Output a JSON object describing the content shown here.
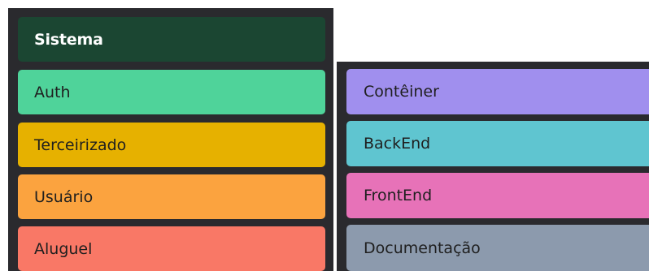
{
  "left_panel": {
    "items": [
      {
        "label": "Sistema",
        "color": "#1b4632",
        "text_color": "#ffffff",
        "kind": "header"
      },
      {
        "label": "Auth",
        "color": "#4fd39a"
      },
      {
        "label": "Terceirizado",
        "color": "#e6b100"
      },
      {
        "label": "Usuário",
        "color": "#fba33f"
      },
      {
        "label": "Aluguel",
        "color": "#f97866"
      }
    ]
  },
  "right_panel": {
    "items": [
      {
        "label": "Contêiner",
        "color": "#a08fee"
      },
      {
        "label": "BackEnd",
        "color": "#5fc5d0"
      },
      {
        "label": "FrontEnd",
        "color": "#e772b8"
      },
      {
        "label": "Documentação",
        "color": "#8c9aad"
      }
    ]
  },
  "theme": {
    "panel_background": "#2a2a2e",
    "page_background": "#ffffff"
  }
}
